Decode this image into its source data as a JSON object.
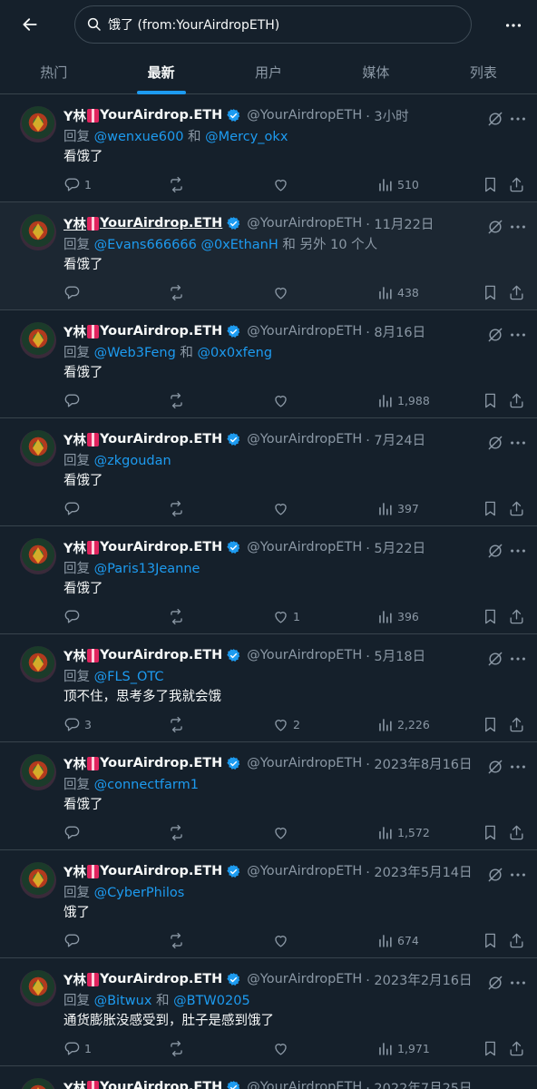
{
  "search": {
    "query": "饿了 (from:YourAirdropETH)"
  },
  "tabs": [
    "热门",
    "最新",
    "用户",
    "媒体",
    "列表"
  ],
  "active_tab": 1,
  "icons": {
    "back": "arrow-left-icon",
    "search": "search-icon",
    "more": "more-icon",
    "verified": "verified-badge-icon",
    "grok": "grok-icon",
    "reply": "reply-icon",
    "retweet": "retweet-icon",
    "like": "like-icon",
    "views": "views-icon",
    "bookmark": "bookmark-icon",
    "share": "share-icon"
  },
  "colors": {
    "accent": "#1d9bf0",
    "background": "#15202b",
    "muted": "#8b98a5",
    "divider": "#38444d"
  },
  "author": {
    "name_prefix": "Y林",
    "name_suffix": "YourAirdrop.ETH",
    "handle": "@YourAirdropETH"
  },
  "reply_prefix": "回复",
  "tweets": [
    {
      "time": "· 3小时",
      "mentions": [
        "@wenxue600",
        " 和 ",
        "@Mercy_okx"
      ],
      "text": "看饿了",
      "replies": "1",
      "retweets": "",
      "likes": "",
      "views": "510"
    },
    {
      "time": "· 11月22日",
      "mentions": [
        "@Evans666666",
        " ",
        "@0xEthanH",
        " 和 另外 10 个人"
      ],
      "text": "看饿了",
      "replies": "",
      "retweets": "",
      "likes": "",
      "views": "438"
    },
    {
      "time": "· 8月16日",
      "mentions": [
        "@Web3Feng",
        " 和 ",
        "@0x0xfeng"
      ],
      "text": "看饿了",
      "replies": "",
      "retweets": "",
      "likes": "",
      "views": "1,988"
    },
    {
      "time": "· 7月24日",
      "mentions": [
        "@zkgoudan"
      ],
      "text": "看饿了",
      "replies": "",
      "retweets": "",
      "likes": "",
      "views": "397"
    },
    {
      "time": "· 5月22日",
      "mentions": [
        "@Paris13Jeanne"
      ],
      "text": "看饿了",
      "replies": "",
      "retweets": "",
      "likes": "1",
      "views": "396"
    },
    {
      "time": "· 5月18日",
      "mentions": [
        "@FLS_OTC"
      ],
      "text": "顶不住，思考多了我就会饿",
      "replies": "3",
      "retweets": "",
      "likes": "2",
      "views": "2,226"
    },
    {
      "time": "· 2023年8月16日",
      "mentions": [
        "@connectfarm1"
      ],
      "text": "看饿了",
      "replies": "",
      "retweets": "",
      "likes": "",
      "views": "1,572"
    },
    {
      "time": "· 2023年5月14日",
      "mentions": [
        "@CyberPhilos"
      ],
      "text": "饿了",
      "replies": "",
      "retweets": "",
      "likes": "",
      "views": "674"
    },
    {
      "time": "· 2023年2月16日",
      "mentions": [
        "@Bitwux",
        " 和 ",
        "@BTW0205"
      ],
      "text": "通货膨胀没感受到，肚子是感到饿了",
      "replies": "1",
      "retweets": "",
      "likes": "",
      "views": "1,971"
    },
    {
      "time": "· 2022年7月25日",
      "mentions": [],
      "text": "",
      "replies": "",
      "retweets": "",
      "likes": "",
      "views": ""
    }
  ]
}
